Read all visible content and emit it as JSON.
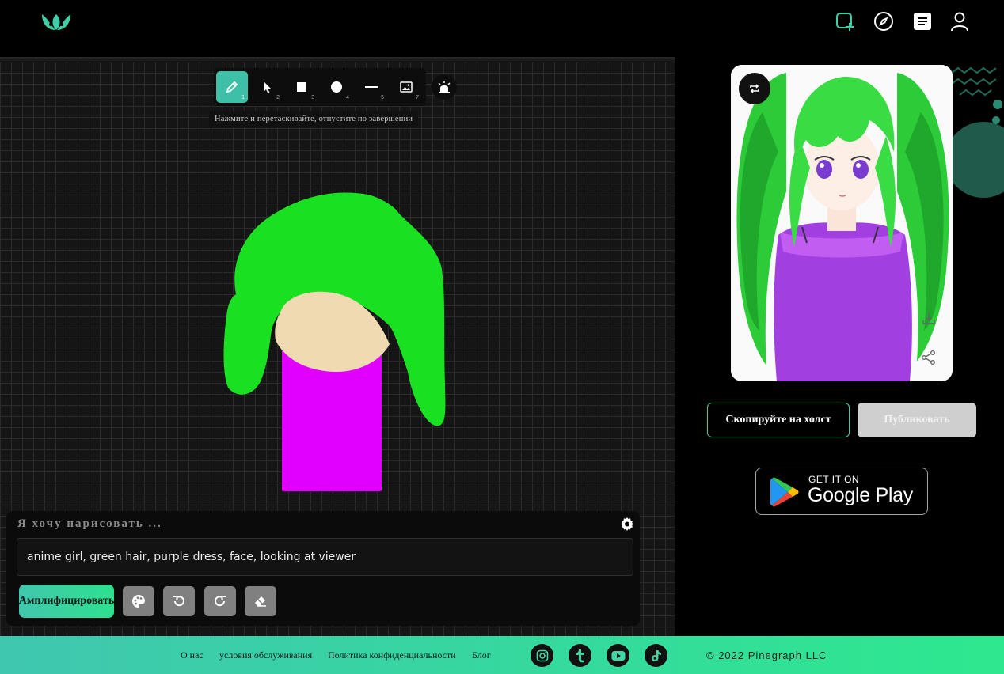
{
  "header": {
    "logo_icon": "lotus-logo",
    "icons": [
      "create-canvas-icon",
      "compass-icon",
      "notes-icon",
      "user-icon"
    ],
    "accent": "#3dcfa8"
  },
  "toolbar": {
    "tools": [
      {
        "icon": "pencil-icon",
        "num": "1"
      },
      {
        "icon": "cursor-icon",
        "num": "2"
      },
      {
        "icon": "square-icon",
        "num": "3"
      },
      {
        "icon": "circle-icon",
        "num": "4"
      },
      {
        "icon": "line-icon",
        "num": "5"
      },
      {
        "icon": "image-icon",
        "num": "7"
      }
    ],
    "tooltip": "Нажмите и перетаскивайте, отпустите по завершении"
  },
  "prompt": {
    "label": "Я хочу нарисовать ...",
    "value": "anime girl, green hair, purple dress, face, looking at viewer",
    "amplify_label": "Амплифицировать"
  },
  "result": {
    "copy_label": "Скопируйте на холст",
    "publish_label": "Публиковать"
  },
  "google_play": {
    "small": "GET IT ON",
    "big": "Google Play"
  },
  "footer": {
    "links": [
      "О нас",
      "условия обслуживания",
      "Политика конфиденциальности",
      "Блог"
    ],
    "social": [
      "instagram-icon",
      "tumblr-icon",
      "youtube-icon",
      "tiktok-icon"
    ],
    "copyright": "© 2022 Pinegraph LLC"
  },
  "colors": {
    "hair": "#19e020",
    "skin": "#f0dab1",
    "dress": "#e100ff",
    "footer_start": "#3fc7b0",
    "footer_end": "#2de88e"
  }
}
